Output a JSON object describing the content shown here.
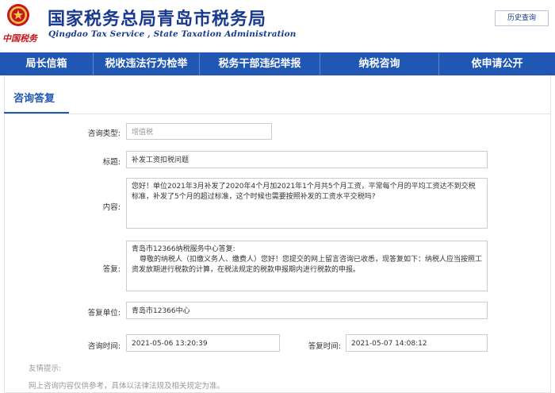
{
  "header": {
    "title": "国家税务总局青岛市税务局",
    "subtitle": "Qingdao Tax Service , State Taxation Administration",
    "brand_mark": "中国税务",
    "history_button": "历史查询"
  },
  "nav": {
    "items": [
      {
        "label": "局长信箱"
      },
      {
        "label": "税收违法行为检举"
      },
      {
        "label": "税务干部违纪举报"
      },
      {
        "label": "纳税咨询"
      },
      {
        "label": "依申请公开"
      }
    ]
  },
  "panel": {
    "tab_label": "咨询答复"
  },
  "form": {
    "type_label": "咨询类型:",
    "type_value": "增值税",
    "title_label": "标题:",
    "title_value": "补发工资扣税问题",
    "content_label": "内容:",
    "content_value": "您好！单位2021年3月补发了2020年4个月加2021年1个月共5个月工资，平常每个月的平均工资达不到交税标准，补发了5个月的超过标准，这个时候也需要按照补发的工资水平交税吗?",
    "reply_label": "答复:",
    "reply_line1": "青岛市12366纳税服务中心答复:",
    "reply_line2": "尊敬的纳税人（扣缴义务人、缴费人）您好！您提交的网上留言咨询已收悉，现答复如下：纳税人应当按照工资发放期进行税款的计算，在税法规定的税款申报期内进行税款的申报。",
    "unit_label": "答复单位:",
    "unit_value": "青岛市12366中心",
    "ask_time_label": "咨询时间:",
    "ask_time_value": "2021-05-06 13:20:39",
    "reply_time_label": "答复时间:",
    "reply_time_value": "2021-05-07 14:08:12"
  },
  "tips": {
    "title": "友情提示:",
    "text": "网上咨询内容仅供参考，具体以法律法规及相关规定为准。"
  },
  "colors": {
    "brand_blue": "#1a3a8f",
    "nav_blue": "#1f57b3",
    "emblem_red": "#c8161d"
  }
}
